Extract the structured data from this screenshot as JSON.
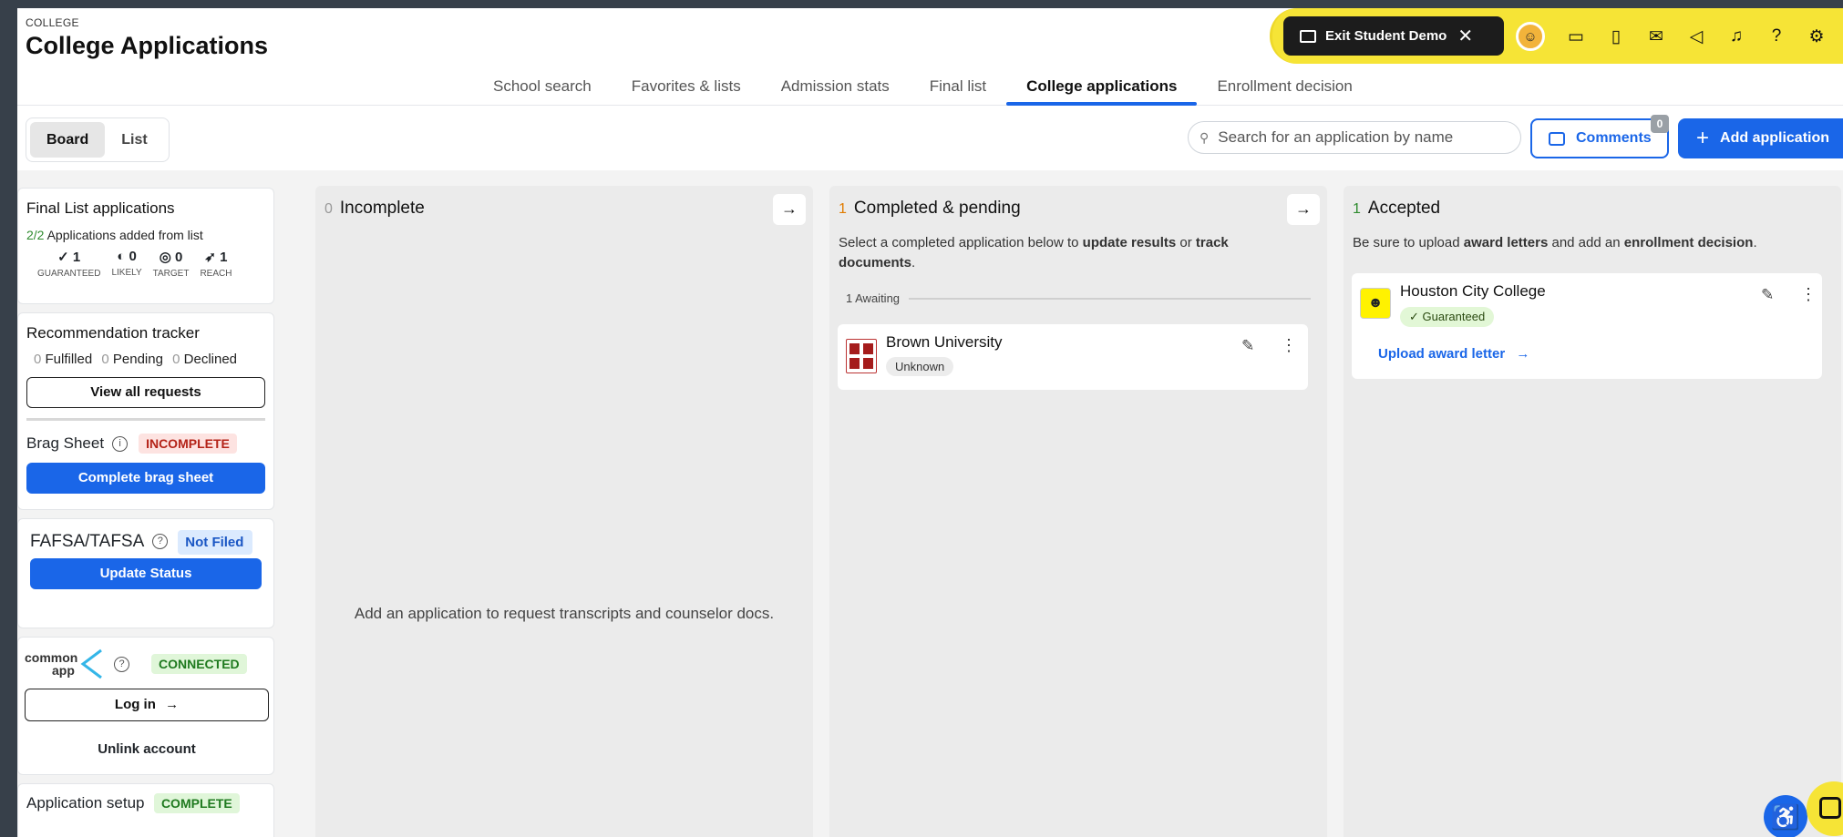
{
  "header": {
    "eyebrow": "COLLEGE",
    "title": "College Applications",
    "tabs": [
      {
        "label": "School search"
      },
      {
        "label": "Favorites & lists"
      },
      {
        "label": "Admission stats"
      },
      {
        "label": "Final list"
      },
      {
        "label": "College applications",
        "active": true
      },
      {
        "label": "Enrollment decision"
      }
    ],
    "exit_demo_label": "Exit Student Demo",
    "exit_close": "✕"
  },
  "toolbar": {
    "board_label": "Board",
    "list_label": "List",
    "search_placeholder": "Search for an application by name",
    "comments_label": "Comments",
    "comments_count": "0",
    "add_label": "Add application"
  },
  "sidebar": {
    "final_list": {
      "title": "Final List applications",
      "added_count": "2/2",
      "added_text": "Applications added from list",
      "stats": [
        {
          "icon": "✓",
          "value": "1",
          "label": "GUARANTEED"
        },
        {
          "icon": "◐",
          "value": "0",
          "label": "LIKELY"
        },
        {
          "icon": "◎",
          "value": "0",
          "label": "TARGET"
        },
        {
          "icon": "➶",
          "value": "1",
          "label": "REACH"
        }
      ]
    },
    "recommendations": {
      "title": "Recommendation tracker",
      "fulfilled_count": "0",
      "fulfilled_label": "Fulfilled",
      "pending_count": "0",
      "pending_label": "Pending",
      "declined_count": "0",
      "declined_label": "Declined",
      "button": "View all requests"
    },
    "brag_sheet": {
      "title": "Brag Sheet",
      "status": "INCOMPLETE",
      "button": "Complete brag sheet"
    },
    "fafsa": {
      "title": "FAFSA/TAFSA",
      "status": "Not Filed",
      "button": "Update Status"
    },
    "common_app": {
      "logo_line1": "common",
      "logo_line2": "app",
      "status": "CONNECTED",
      "login_label": "Log in",
      "unlink_label": "Unlink account"
    },
    "app_setup": {
      "title": "Application setup",
      "status": "COMPLETE"
    }
  },
  "columns": {
    "incomplete": {
      "count": "0",
      "title": "Incomplete",
      "empty_text": "Add an application to request transcripts and counselor docs."
    },
    "completed": {
      "count": "1",
      "title": "Completed & pending",
      "desc_1": "Select a completed application below to ",
      "desc_b1": "update results",
      "desc_2": " or ",
      "desc_b2": "track documents",
      "desc_3": ".",
      "awaiting_label": "1 Awaiting",
      "cards": [
        {
          "name": "Brown University",
          "status": "Unknown"
        }
      ]
    },
    "accepted": {
      "count": "1",
      "title": "Accepted",
      "desc_1": "Be sure to upload ",
      "desc_b1": "award letters",
      "desc_2": " and add an ",
      "desc_b2": "enrollment decision",
      "desc_3": ".",
      "cards": [
        {
          "name": "Houston City College",
          "status": "Guaranteed",
          "action": "Upload award letter"
        }
      ]
    }
  },
  "colors": {
    "accent": "#1a66e8",
    "demo_bar": "#f6e436",
    "count_orange": "#e07b00",
    "count_green": "#2e8b2e"
  }
}
